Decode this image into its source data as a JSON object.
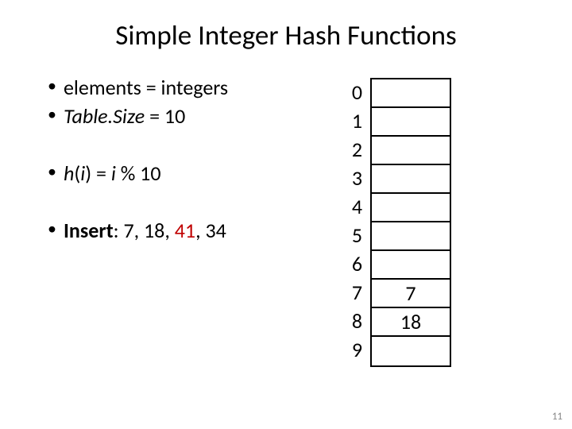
{
  "title": "Simple Integer Hash Functions",
  "bullets": {
    "b1_a": "elements = integers",
    "b2_a": "Table.Size",
    "b2_b": " = 10",
    "b3_a": "h",
    "b3_b": "(",
    "b3_c": "i",
    "b3_d": ") = ",
    "b3_e": "i ",
    "b3_f": "% 10",
    "b4_a": "Insert",
    "b4_b": ": 7, 18, ",
    "b4_c": "41",
    "b4_d": ", 34"
  },
  "table": {
    "indices": [
      "0",
      "1",
      "2",
      "3",
      "4",
      "5",
      "6",
      "7",
      "8",
      "9"
    ],
    "cells": [
      "",
      "",
      "",
      "",
      "",
      "",
      "",
      "7",
      "18",
      ""
    ]
  },
  "page_number": "11"
}
